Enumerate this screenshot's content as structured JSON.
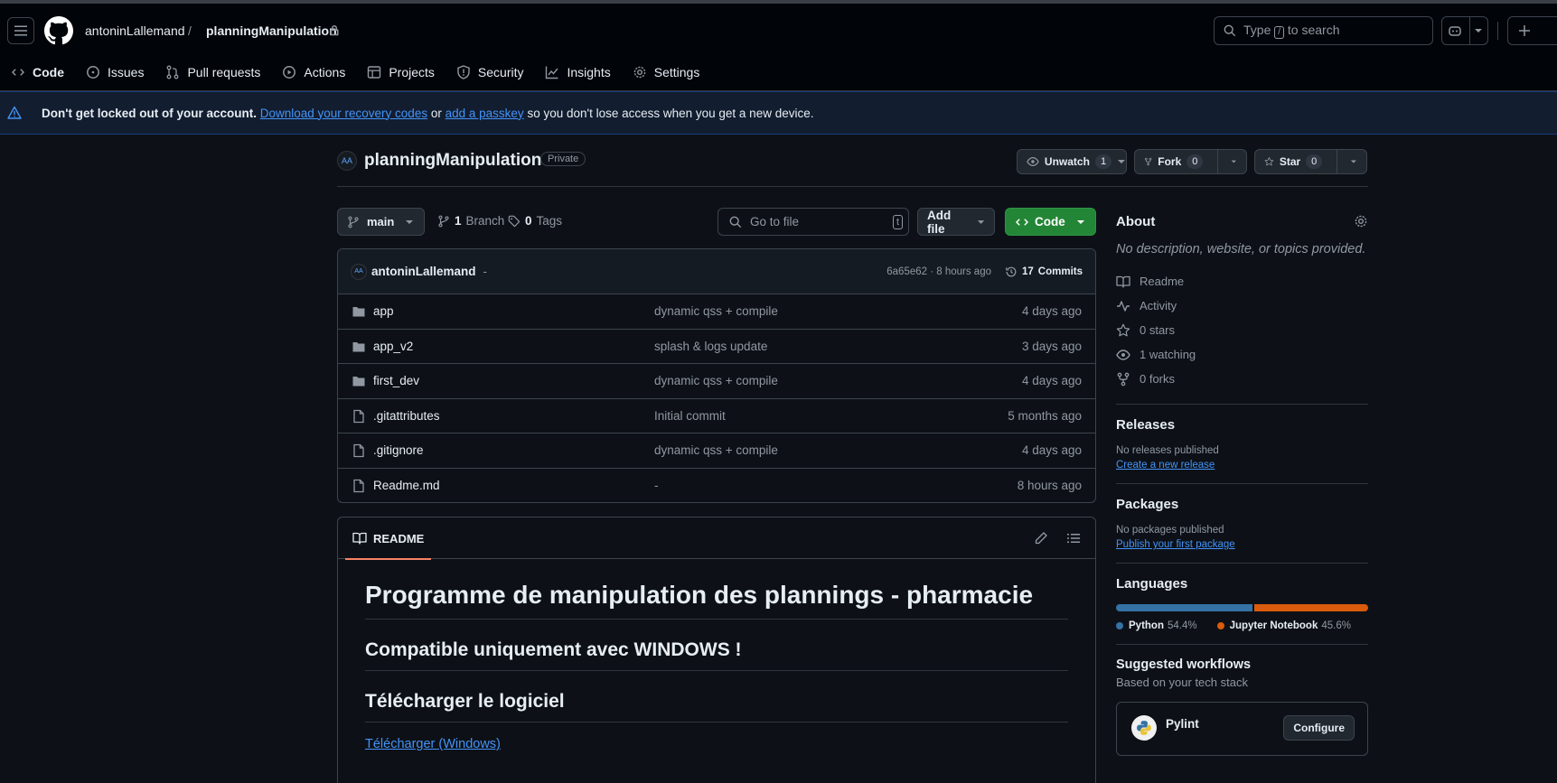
{
  "header": {
    "owner": "antoninLallemand",
    "separator": "/",
    "repo": "planningManipulation",
    "search_prefix": "Type",
    "search_key": "/",
    "search_suffix": "to search"
  },
  "tabs": [
    {
      "label": "Code",
      "icon": "code-icon",
      "active": true
    },
    {
      "label": "Issues",
      "icon": "issue-icon"
    },
    {
      "label": "Pull requests",
      "icon": "pull-request-icon"
    },
    {
      "label": "Actions",
      "icon": "play-icon"
    },
    {
      "label": "Projects",
      "icon": "table-icon"
    },
    {
      "label": "Security",
      "icon": "shield-icon"
    },
    {
      "label": "Insights",
      "icon": "graph-icon"
    },
    {
      "label": "Settings",
      "icon": "gear-icon"
    }
  ],
  "banner": {
    "bold": "Don't get locked out of your account.",
    "link1": "Download your recovery codes",
    "mid": "or",
    "link2": "add a passkey",
    "tail": "so you don't lose access when you get a new device."
  },
  "repo": {
    "name": "planningManipulation",
    "visibility": "Private",
    "watch_label": "Unwatch",
    "watch_count": "1",
    "fork_label": "Fork",
    "fork_count": "0",
    "star_label": "Star",
    "star_count": "0"
  },
  "toolbar": {
    "branch": "main",
    "branches_count": "1",
    "branches_label": "Branch",
    "tags_count": "0",
    "tags_label": "Tags",
    "goto_placeholder": "Go to file",
    "goto_key": "t",
    "add_file": "Add file",
    "code": "Code"
  },
  "commit": {
    "author": "antoninLallemand",
    "message": "-",
    "hash_time": "6a65e62 · 8 hours ago",
    "commits_count": "17",
    "commits_label": "Commits"
  },
  "files": [
    {
      "name": "app",
      "type": "folder",
      "message": "dynamic qss + compile",
      "date": "4 days ago"
    },
    {
      "name": "app_v2",
      "type": "folder",
      "message": "splash & logs update",
      "date": "3 days ago"
    },
    {
      "name": "first_dev",
      "type": "folder",
      "message": "dynamic qss + compile",
      "date": "4 days ago"
    },
    {
      "name": ".gitattributes",
      "type": "file",
      "message": "Initial commit",
      "date": "5 months ago"
    },
    {
      "name": ".gitignore",
      "type": "file",
      "message": "dynamic qss + compile",
      "date": "4 days ago"
    },
    {
      "name": "Readme.md",
      "type": "file",
      "message": "-",
      "date": "8 hours ago"
    }
  ],
  "readme": {
    "tab": "README",
    "h1": "Programme de manipulation des plannings - pharmacie",
    "h2a": "Compatible uniquement avec WINDOWS !",
    "h2b": "Télécharger le logiciel",
    "link": "Télécharger (Windows)"
  },
  "about": {
    "title": "About",
    "description": "No description, website, or topics provided.",
    "items": [
      "Readme",
      "Activity",
      "0 stars",
      "1 watching",
      "0 forks"
    ]
  },
  "releases": {
    "title": "Releases",
    "text": "No releases published",
    "link": "Create a new release"
  },
  "packages": {
    "title": "Packages",
    "text": "No packages published",
    "link": "Publish your first package"
  },
  "languages": {
    "title": "Languages",
    "items": [
      {
        "name": "Python",
        "percent": "54.4%",
        "share": 54.4,
        "color": "#3572A5"
      },
      {
        "name": "Jupyter Notebook",
        "percent": "45.6%",
        "share": 45.6,
        "color": "#DA5B0B"
      }
    ]
  },
  "workflows": {
    "title": "Suggested workflows",
    "subtitle": "Based on your tech stack",
    "item": "Pylint",
    "button": "Configure"
  },
  "colors": {
    "accent": "#f78166",
    "link": "#4493f8",
    "green": "#238636"
  }
}
